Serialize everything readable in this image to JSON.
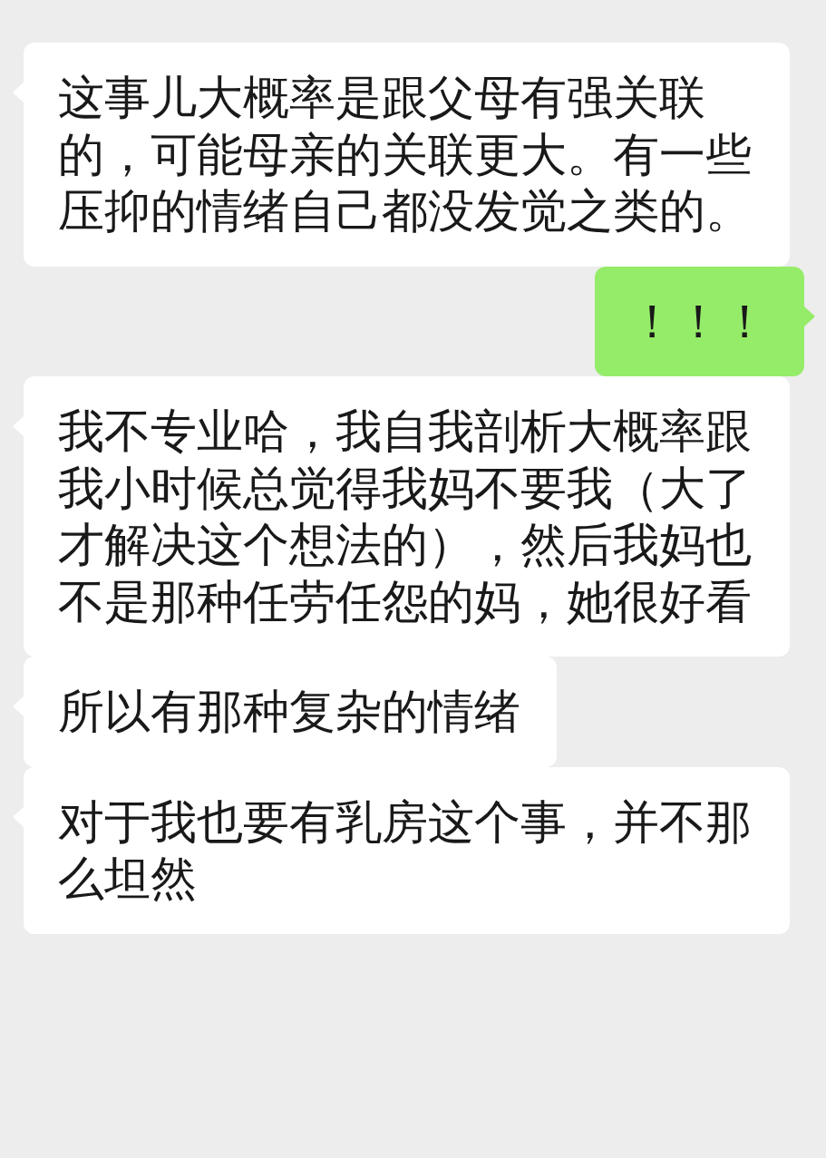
{
  "messages": [
    {
      "kind": "received",
      "text": "这事儿大概率是跟父母有强关联的，可能母亲的关联更大。有一些压抑的情绪自己都没发觉之类的。"
    },
    {
      "kind": "sent",
      "text": "！！！"
    },
    {
      "kind": "received",
      "text": "我不专业哈，我自我剖析大概率跟我小时候总觉得我妈不要我（大了才解决这个想法的），然后我妈也不是那种任劳任怨的妈，她很好看"
    },
    {
      "kind": "received",
      "text": "所以有那种复杂的情绪"
    },
    {
      "kind": "received",
      "text": "对于我也要有乳房这个事，并不那么坦然"
    }
  ]
}
